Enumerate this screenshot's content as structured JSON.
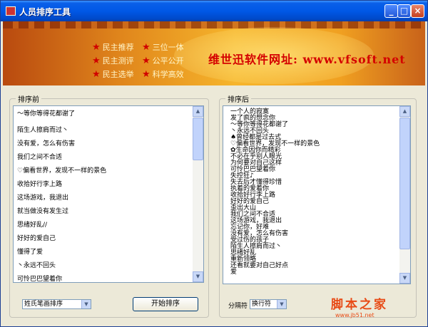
{
  "window": {
    "title": "人员排序工具",
    "buttons": [
      "_",
      "□",
      "×"
    ]
  },
  "banner": {
    "slogans": [
      "民主推荐",
      "三位一体",
      "民主测评",
      "公平公开",
      "民主选举",
      "科学高效"
    ],
    "site_text": "维世迅软件网址: www.vfsoft.net"
  },
  "left_panel": {
    "label": "排序前",
    "items": [
      "〜等你等得花都谢了",
      "陌生人擦肩而过丶",
      "没有爱，怎么有伤害",
      "我们之间不合适",
      "♡偏看世界，发现不一样的景色",
      "收拾好行李上路",
      "这场游戏，我退出",
      "就当做没有发生过",
      "思绪好乱//",
      "好好的爱自己",
      "懂得了爱",
      "丶永远不回头",
      "可怜巴巴望着你"
    ]
  },
  "right_panel": {
    "label": "排序后",
    "items": [
      "一个人的寂寞",
      "发了疯的想念你",
      "〜等你等得花都谢了",
      "丶永远不回头",
      "♠曾经都是过去式",
      "♡偏看世界，发现不一样的景色",
      "✿生命因你而精彩",
      "不必在乎别人眼光",
      "为何要对自己这样",
      "可怜巴巴望着你",
      "失控狂♪",
      "失去后才懂得珍惜",
      "执着的爱着你",
      "收拾好行李上路",
      "好好的爱自己",
      "歪出大山",
      "我们之间不合适",
      "这场游戏，我退出",
      "忘记你，好难",
      "没有爱，怎么有伤害",
      "受过伤的孩子",
      "陌生人擦肩而过丶",
      "思绪好乱",
      "重新领略",
      "还看就要对自己好点",
      "爱"
    ]
  },
  "controls": {
    "sort_mode_value": "姓氏笔画排序",
    "start_button": "开始排序",
    "separator_label": "分隔符",
    "separator_value": "换行符"
  },
  "watermark": {
    "big": "脚本之家",
    "small": "www.jb51.net"
  },
  "colors": {
    "titlebar": "#0058e6",
    "banner": "#f6b52c",
    "site_text": "#d40000",
    "watermark": "#e84b16"
  }
}
